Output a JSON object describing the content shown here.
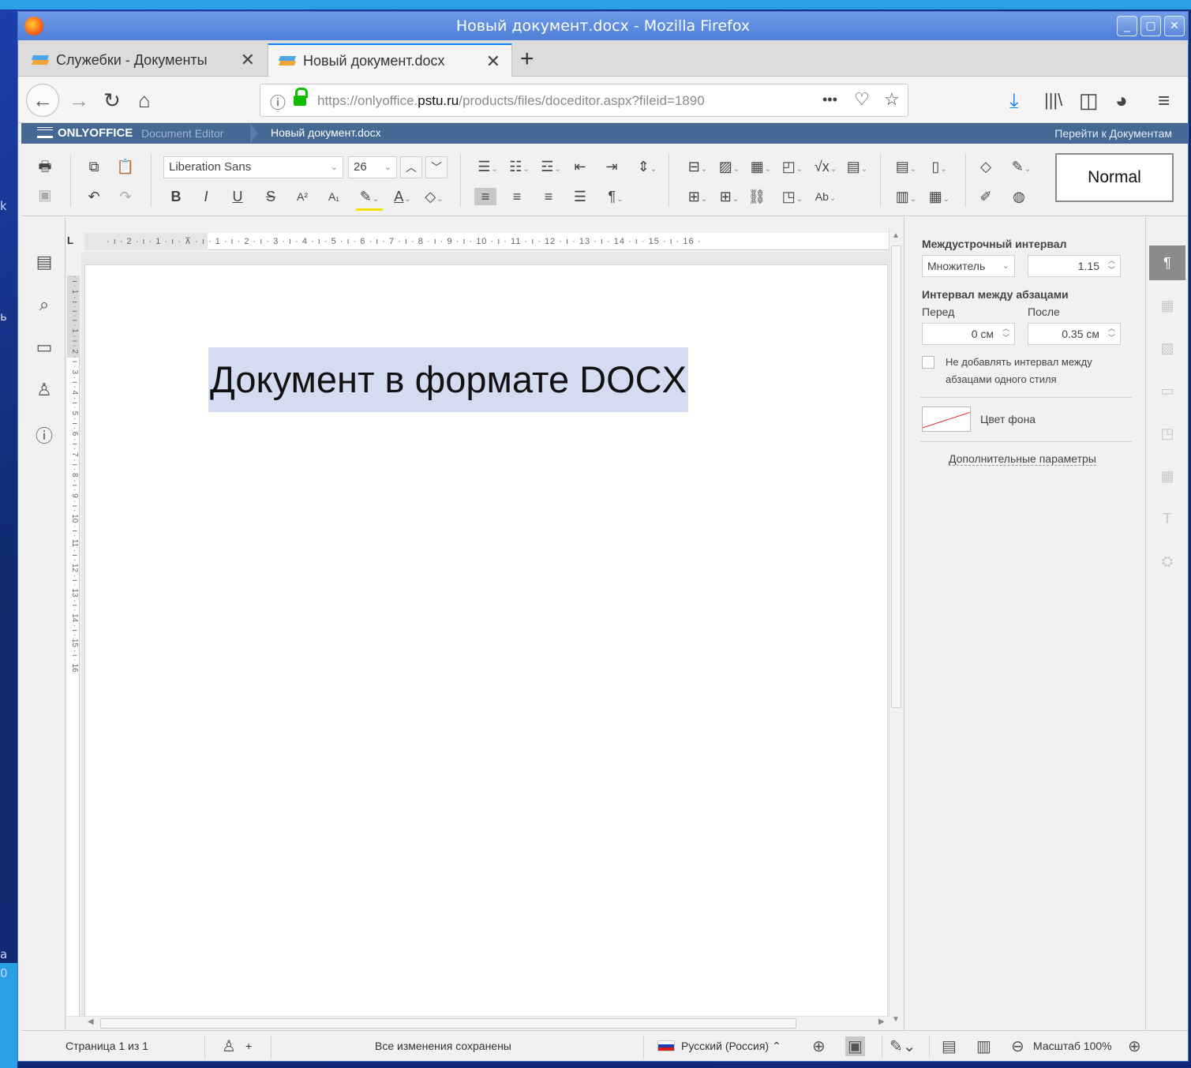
{
  "window": {
    "title": "Новый документ.docx - Mozilla Firefox",
    "buttons": [
      "_",
      "▢",
      "✕"
    ]
  },
  "desktop_fragments": [
    "k",
    "ь",
    "a",
    "0"
  ],
  "tabs": [
    {
      "label": "Служебки - Документы",
      "close": "✕",
      "active": false
    },
    {
      "label": "Новый документ.docx",
      "close": "✕",
      "active": true
    }
  ],
  "new_tab": "+",
  "nav": {
    "url_prefix": "https://onlyoffice.",
    "url_domain": "pstu.ru",
    "url_suffix": "/products/files/doceditor.aspx?fileid=1890",
    "more": "•••"
  },
  "oo_header": {
    "logo": "ONLYOFFICE",
    "app": "Document Editor",
    "doc_name": "Новый документ.docx",
    "go_to_docs": "Перейти к Документам"
  },
  "toolbar": {
    "font_name": "Liberation Sans",
    "font_size": "26",
    "style": "Normal",
    "bold": "B",
    "italic": "I",
    "underline": "U",
    "strike": "S",
    "superscript": "A²",
    "subscript": "A₁",
    "font_color": "A",
    "nonprinting": "¶"
  },
  "ruler": {
    "h_numbers": "· ı · 2 · ı · 1 · ı · ⊼ · ı · 1 · ı · 2 · ı · 3 · ı · 4 · ı · 5 · ı · 6 · ı · 7 · ı · 8 · ı · 9 · ı · 10 · ı · 11 · ı · 12 · ı · 13 · ı · 14 · ı · 15 · ı · 16 ·",
    "v_numbers": "· ı · 1 · ı · ı · ı · 1 · ı · 2 · ı · 3 · ı · 4 · ı · 5 · ı · 6 · ı · 7 · ı · 8 · ı · 9 · ı · 10 · ı · 11 · ı · 12 · ı · 13 · ı · 14 · ı · 15 · ı · 16",
    "corner": "L"
  },
  "document": {
    "text": "Документ в формате DOCX"
  },
  "right_panel": {
    "line_spacing_label": "Междустрочный интервал",
    "line_spacing_mode": "Множитель",
    "line_spacing_value": "1.15",
    "para_spacing_label": "Интервал между абзацами",
    "before_label": "Перед",
    "after_label": "После",
    "before_value": "0 см",
    "after_value": "0.35 см",
    "no_spacing_label_1": "Не добавлять интервал между",
    "no_spacing_label_2": "абзацами одного стиля",
    "bg_color_label": "Цвет фона",
    "advanced_link": "Дополнительные параметры"
  },
  "status_bar": {
    "page": "Страница 1 из 1",
    "add_user": "+",
    "saved": "Все изменения сохранены",
    "language": "Русский (Россия)",
    "zoom": "Масштаб 100%"
  }
}
